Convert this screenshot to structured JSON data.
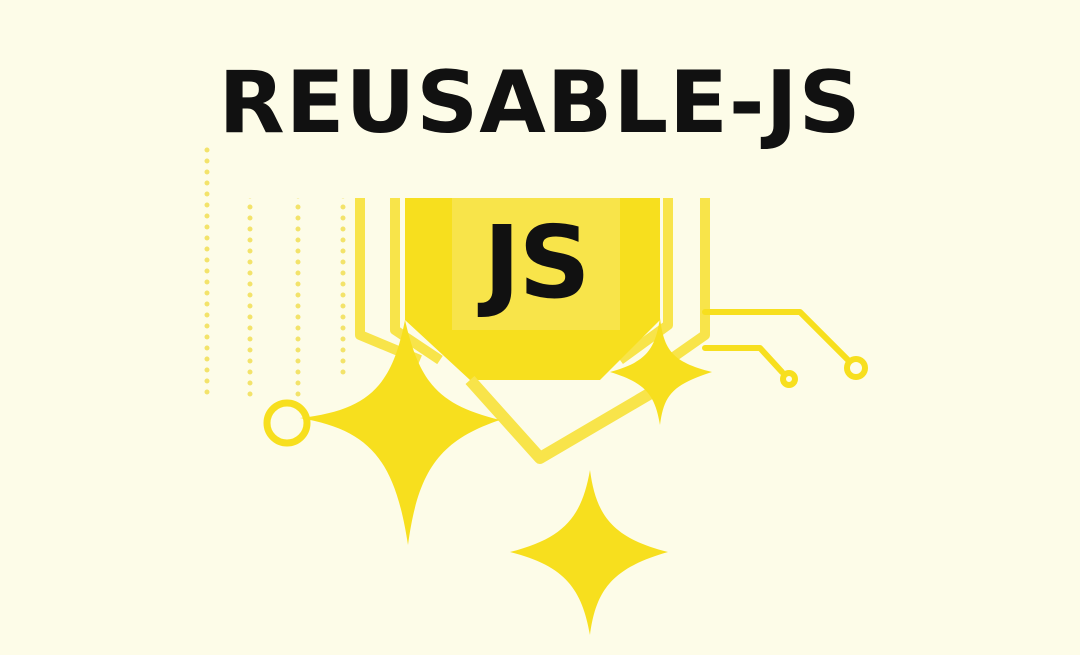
{
  "title": "REUSABLE-JS",
  "badge_text": "JS",
  "colors": {
    "background": "#fdfce8",
    "accent_yellow": "#f7df1e",
    "soft_yellow": "#f8e44a",
    "text": "#111111"
  },
  "icons": [
    "javascript-logo-icon",
    "sparkle-icon",
    "circuit-line-icon",
    "dotted-lines-icon"
  ]
}
